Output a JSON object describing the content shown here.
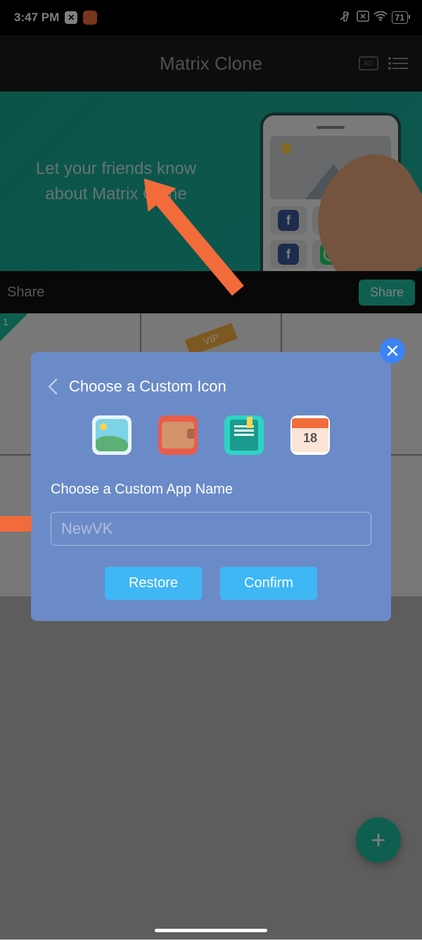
{
  "status": {
    "time": "3:47 PM",
    "battery": "71"
  },
  "header": {
    "title": "Matrix Clone"
  },
  "promo": {
    "text": "Let your friends know about Matrix Clone"
  },
  "share": {
    "label": "Share",
    "button": "Share"
  },
  "grid": {
    "badge1": "1",
    "vip": "VIP"
  },
  "dialog": {
    "title": "Choose a Custom Icon",
    "subtitle": "Choose a Custom App Name",
    "input_value": "NewVK",
    "restore": "Restore",
    "confirm": "Confirm",
    "calendar_date": "18"
  },
  "fab": {
    "label": "+"
  }
}
